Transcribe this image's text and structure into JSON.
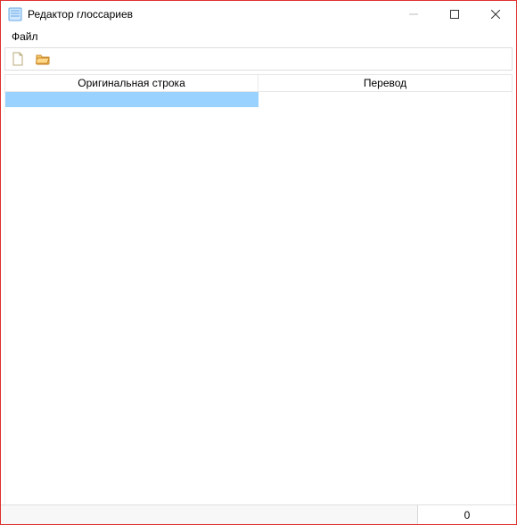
{
  "window": {
    "title": "Редактор глоссариев"
  },
  "menu": {
    "file": "Файл"
  },
  "toolbar": {
    "new_tooltip": "New",
    "open_tooltip": "Open"
  },
  "table": {
    "columns": {
      "original": "Оригинальная строка",
      "translation": "Перевод"
    },
    "rows": [
      {
        "original": "",
        "translation": "",
        "selected": true
      }
    ]
  },
  "status": {
    "count": "0"
  }
}
